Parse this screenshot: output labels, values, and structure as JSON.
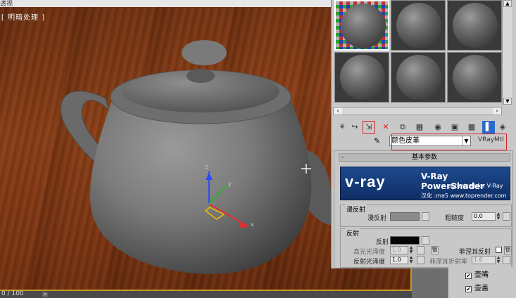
{
  "viewport": {
    "top_text": "透视",
    "label": "[ 明暗处理 ]",
    "frame_counter": "0 / 100",
    "track_arrow": ">",
    "gizmo_axes": [
      "x",
      "y",
      "z"
    ]
  },
  "material_editor": {
    "slot_count": 6,
    "toolbar_icons": [
      "get-material-icon",
      "put-to-scene-icon",
      "assign-to-selection-icon",
      "reset-map-icon",
      "make-unique-icon",
      "put-to-library-icon",
      "material-id-icon",
      "show-map-icon",
      "show-end-result-icon",
      "go-to-parent-icon",
      "go-forward-icon",
      "pick-from-object-icon"
    ],
    "material_name": "颜色皮革",
    "material_type": "VRayMtl",
    "rollout_title": "基本参数",
    "banner": {
      "logo": "v-ray",
      "product": "V-Ray PowerShader",
      "subtitle": "optimized for V-Ray",
      "credit": "汉化 :ma5 www.toprender.com"
    },
    "diffuse": {
      "group": "漫反射",
      "label": "漫反射",
      "roughness_label": "粗糙度",
      "roughness_value": "0.0"
    },
    "reflection": {
      "group": "反射",
      "label": "反射",
      "hilight_label": "高光光泽度",
      "hilight_value": "1.0",
      "lock_label": "锁",
      "fresnel_label": "菲涅耳反射",
      "fresnel_lock": "锁",
      "refl_gloss_label": "反射光泽度",
      "refl_gloss_value": "1.0",
      "fresnel_ior_label": "菲涅耳折射率",
      "fresnel_ior_value": "1.6"
    }
  },
  "object_list": {
    "items": [
      {
        "label": "壶嘴",
        "checked": true
      },
      {
        "label": "壶盖",
        "checked": true
      }
    ]
  },
  "colors": {
    "accent_red": "#dd2222",
    "viewport_border": "#c89a1e",
    "banner_blue": "#1d4a8c"
  }
}
